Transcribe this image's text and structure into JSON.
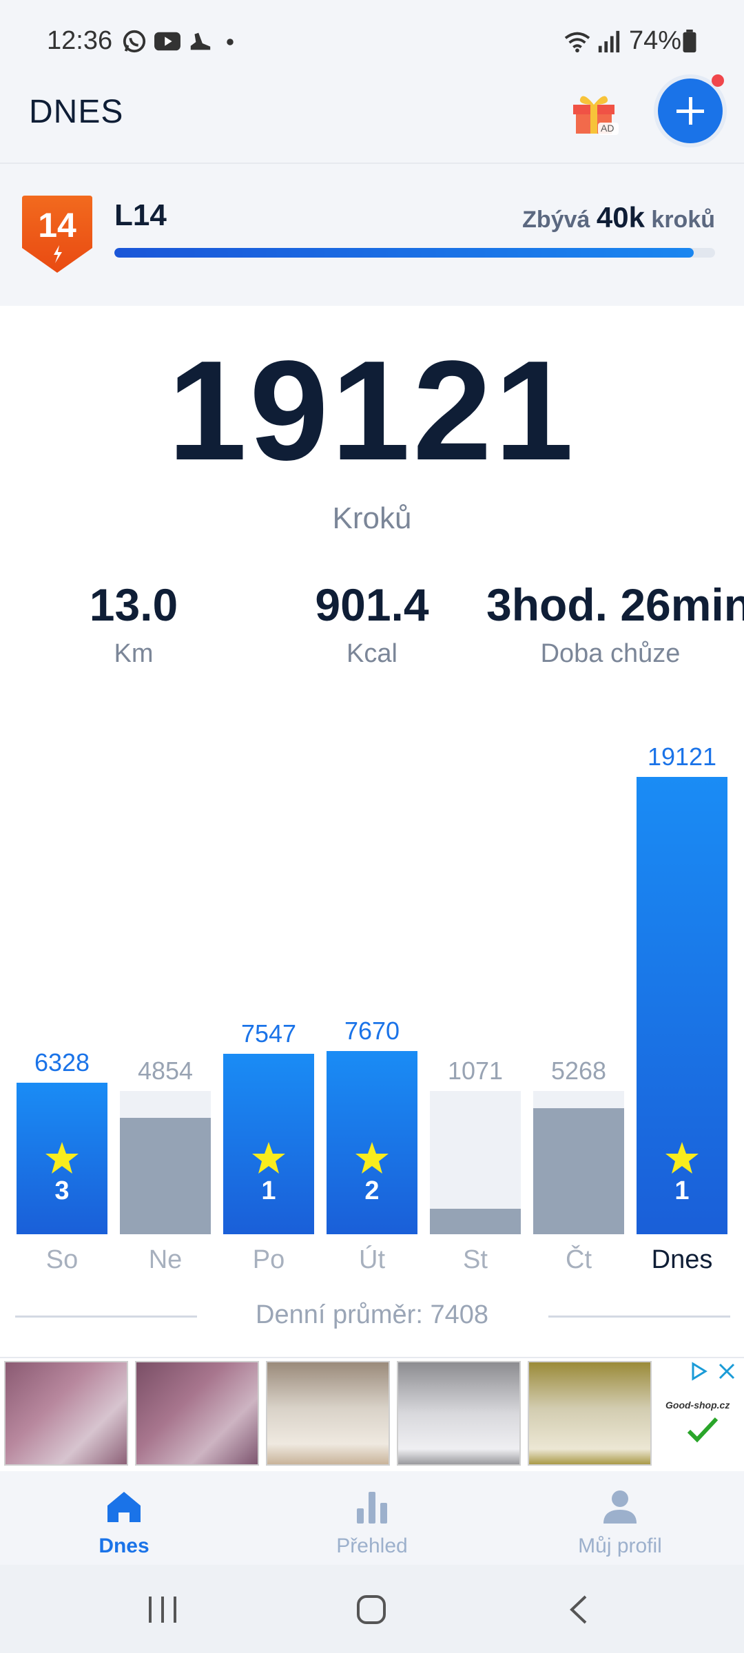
{
  "status_bar": {
    "time": "12:36",
    "battery": "74%",
    "icons": [
      "whatsapp-icon",
      "youtube-icon",
      "shoe-icon",
      "dot-icon",
      "wifi-icon",
      "signal-icon",
      "battery-icon"
    ]
  },
  "header": {
    "title": "DNES",
    "gift_badge": "AD"
  },
  "level": {
    "badge_number": "14",
    "name": "L14",
    "remaining_prefix": "Zbývá",
    "remaining_value": "40k",
    "remaining_suffix": "kroků",
    "progress_fraction": 0.965
  },
  "summary": {
    "steps": "19121",
    "steps_label": "Kroků",
    "distance_value": "13.0",
    "distance_label": "Km",
    "calories_value": "901.4",
    "calories_label": "Kcal",
    "time_value": "3hod. 26min.",
    "time_label": "Doba chůze"
  },
  "chart_data": {
    "type": "bar",
    "categories": [
      "So",
      "Ne",
      "Po",
      "Út",
      "St",
      "Čt",
      "Dnes"
    ],
    "values": [
      6328,
      4854,
      7547,
      7670,
      1071,
      5268,
      19121
    ],
    "stars": [
      3,
      null,
      1,
      2,
      null,
      null,
      1
    ],
    "goal_met": [
      true,
      false,
      true,
      true,
      false,
      false,
      true
    ],
    "colors": {
      "goal_met": "#1a7ff0",
      "goal_not_met": "#95a3b5",
      "goal_background": "#eef1f6",
      "label_met": "#1a73e8",
      "label_not_met": "#98a3b3"
    },
    "average_label": "Denní průměr: 7408"
  },
  "ad": {
    "brand": "Good-shop.cz"
  },
  "bottom_nav": {
    "items": [
      {
        "label": "Dnes",
        "icon": "home-icon",
        "active": true
      },
      {
        "label": "Přehled",
        "icon": "bar-chart-icon",
        "active": false
      },
      {
        "label": "Můj profil",
        "icon": "person-icon",
        "active": false
      }
    ]
  },
  "colors": {
    "accent": "#1a73e8",
    "text_dark": "#0f1e36",
    "text_muted": "#7b8698"
  }
}
